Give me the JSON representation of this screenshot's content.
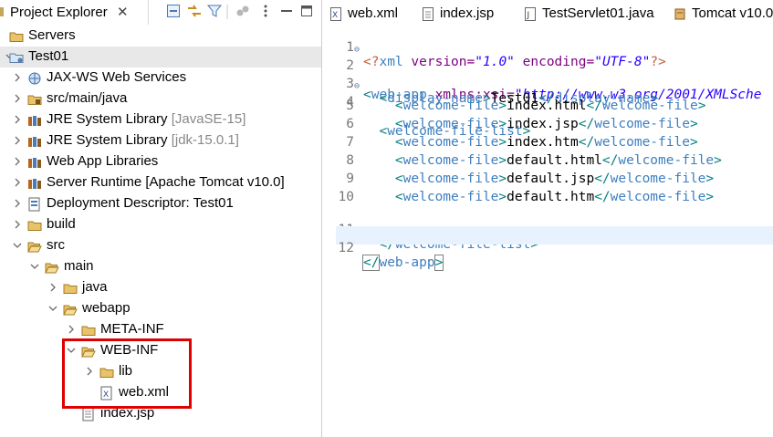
{
  "explorer": {
    "title": "Project Explorer",
    "close_glyph": "✕",
    "tree": [
      {
        "label": "Servers",
        "deco": "",
        "icon": "folder-icon",
        "expanded": null,
        "selected": false
      },
      {
        "label": "Test01",
        "deco": "",
        "icon": "project-icon",
        "expanded": true,
        "selected": true
      },
      {
        "label": "JAX-WS Web Services",
        "deco": "",
        "icon": "webservice-icon",
        "expanded": false,
        "selected": false
      },
      {
        "label": "src/main/java",
        "deco": "",
        "icon": "source-folder-icon",
        "expanded": false,
        "selected": false
      },
      {
        "label": "JRE System Library ",
        "deco": "[JavaSE-15]",
        "icon": "library-icon",
        "expanded": false,
        "selected": false
      },
      {
        "label": "JRE System Library ",
        "deco": "[jdk-15.0.1]",
        "icon": "library-icon",
        "expanded": false,
        "selected": false
      },
      {
        "label": "Web App Libraries",
        "deco": "",
        "icon": "library-icon",
        "expanded": false,
        "selected": false
      },
      {
        "label": "Server Runtime [Apache Tomcat v10.0]",
        "deco": "",
        "icon": "library-icon",
        "expanded": false,
        "selected": false
      },
      {
        "label": "Deployment Descriptor: Test01",
        "deco": "",
        "icon": "descriptor-icon",
        "expanded": false,
        "selected": false
      },
      {
        "label": "build",
        "deco": "",
        "icon": "folder-icon",
        "expanded": false,
        "selected": false
      },
      {
        "label": "src",
        "deco": "",
        "icon": "folder-open-icon",
        "expanded": true,
        "selected": false
      },
      {
        "label": "main",
        "deco": "",
        "icon": "folder-open-icon",
        "expanded": true,
        "selected": false
      },
      {
        "label": "java",
        "deco": "",
        "icon": "folder-icon",
        "expanded": false,
        "selected": false
      },
      {
        "label": "webapp",
        "deco": "",
        "icon": "folder-open-icon",
        "expanded": true,
        "selected": false
      },
      {
        "label": "META-INF",
        "deco": "",
        "icon": "folder-icon",
        "expanded": false,
        "selected": false
      },
      {
        "label": "WEB-INF",
        "deco": "",
        "icon": "folder-open-icon",
        "expanded": true,
        "selected": false
      },
      {
        "label": "lib",
        "deco": "",
        "icon": "folder-icon",
        "expanded": false,
        "selected": false
      },
      {
        "label": "web.xml",
        "deco": "",
        "icon": "xml-file-icon",
        "expanded": null,
        "selected": false
      },
      {
        "label": "index.jsp",
        "deco": "",
        "icon": "jsp-file-icon",
        "expanded": null,
        "selected": false
      }
    ]
  },
  "editor": {
    "tabs": [
      {
        "label": "web.xml",
        "icon": "xml-file-icon"
      },
      {
        "label": "index.jsp",
        "icon": "jsp-file-icon"
      },
      {
        "label": "TestServlet01.java",
        "icon": "java-file-icon"
      },
      {
        "label": "Tomcat v10.0",
        "icon": "server-icon"
      }
    ],
    "line_numbers": [
      "1",
      "2",
      "3",
      "4",
      "5",
      "6",
      "7",
      "8",
      "9",
      "10",
      "11",
      "12"
    ],
    "code": {
      "l1": {
        "open": "<?",
        "name": "xml",
        "a1": " version=",
        "v1": "\"1.0\"",
        "a2": " encoding=",
        "v2": "\"UTF-8\"",
        "close": "?>"
      },
      "l2": {
        "open": "<",
        "tag": "web-app",
        "attr": " xmlns:xsi=",
        "val": "\"http://www.w3.org/2001/XMLSche"
      },
      "l3": {
        "indent": "  ",
        "open": "<",
        "tag": "display-name",
        "gt": ">",
        "text": "Test01",
        "close_open": "</",
        "close_tag": "display-name",
        "close_gt": ">"
      },
      "l4": {
        "indent": "  ",
        "open": "<",
        "tag": "welcome-file-list",
        "gt": ">"
      },
      "welcome_files": [
        "index.html",
        "index.jsp",
        "index.htm",
        "default.html",
        "default.jsp",
        "default.htm"
      ],
      "welcome_tag": "welcome-file",
      "l11": {
        "indent": "  ",
        "open": "</",
        "tag": "welcome-file-list",
        "gt": ">"
      },
      "l12": {
        "open": "</",
        "tag": "web-app",
        "gt": ">"
      }
    }
  },
  "colors": {
    "highlight": "#e00000",
    "tag": "#3f7fbf",
    "bracket": "#008080",
    "attr_name": "#7f007f",
    "attr_value": "#2a00ff"
  }
}
